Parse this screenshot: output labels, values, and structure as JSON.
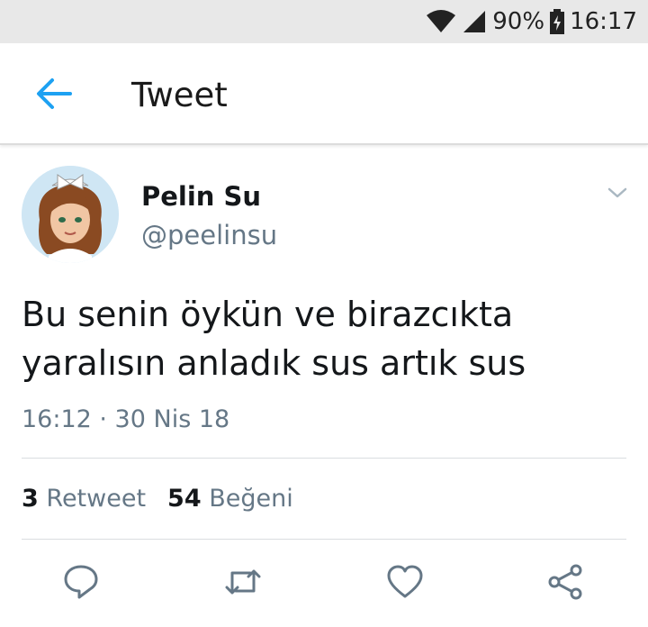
{
  "status_bar": {
    "battery": "90%",
    "time": "16:17",
    "icons": [
      "wifi-icon",
      "signal-icon",
      "battery-charging-icon"
    ]
  },
  "app_bar": {
    "title": "Tweet",
    "back_icon": "arrow-left-icon"
  },
  "tweet": {
    "author_name": "Pelin Su",
    "author_handle": "@peelinsu",
    "text_line1": "Bu senin öykün ve birazcıkta",
    "text_line2": "yaralısın anladık sus artık sus",
    "timestamp": "16:12 · 30 Nis 18",
    "retweet_count": "3",
    "retweet_label": "Retweet",
    "like_count": "54",
    "like_label": "Beğeni"
  },
  "actions": [
    "reply-icon",
    "retweet-icon",
    "like-icon",
    "share-icon"
  ],
  "colors": {
    "accent": "#1da1f2",
    "secondary_text": "#657786",
    "status_bar_bg": "#e8e8e8",
    "icon_gray": "#657786"
  }
}
